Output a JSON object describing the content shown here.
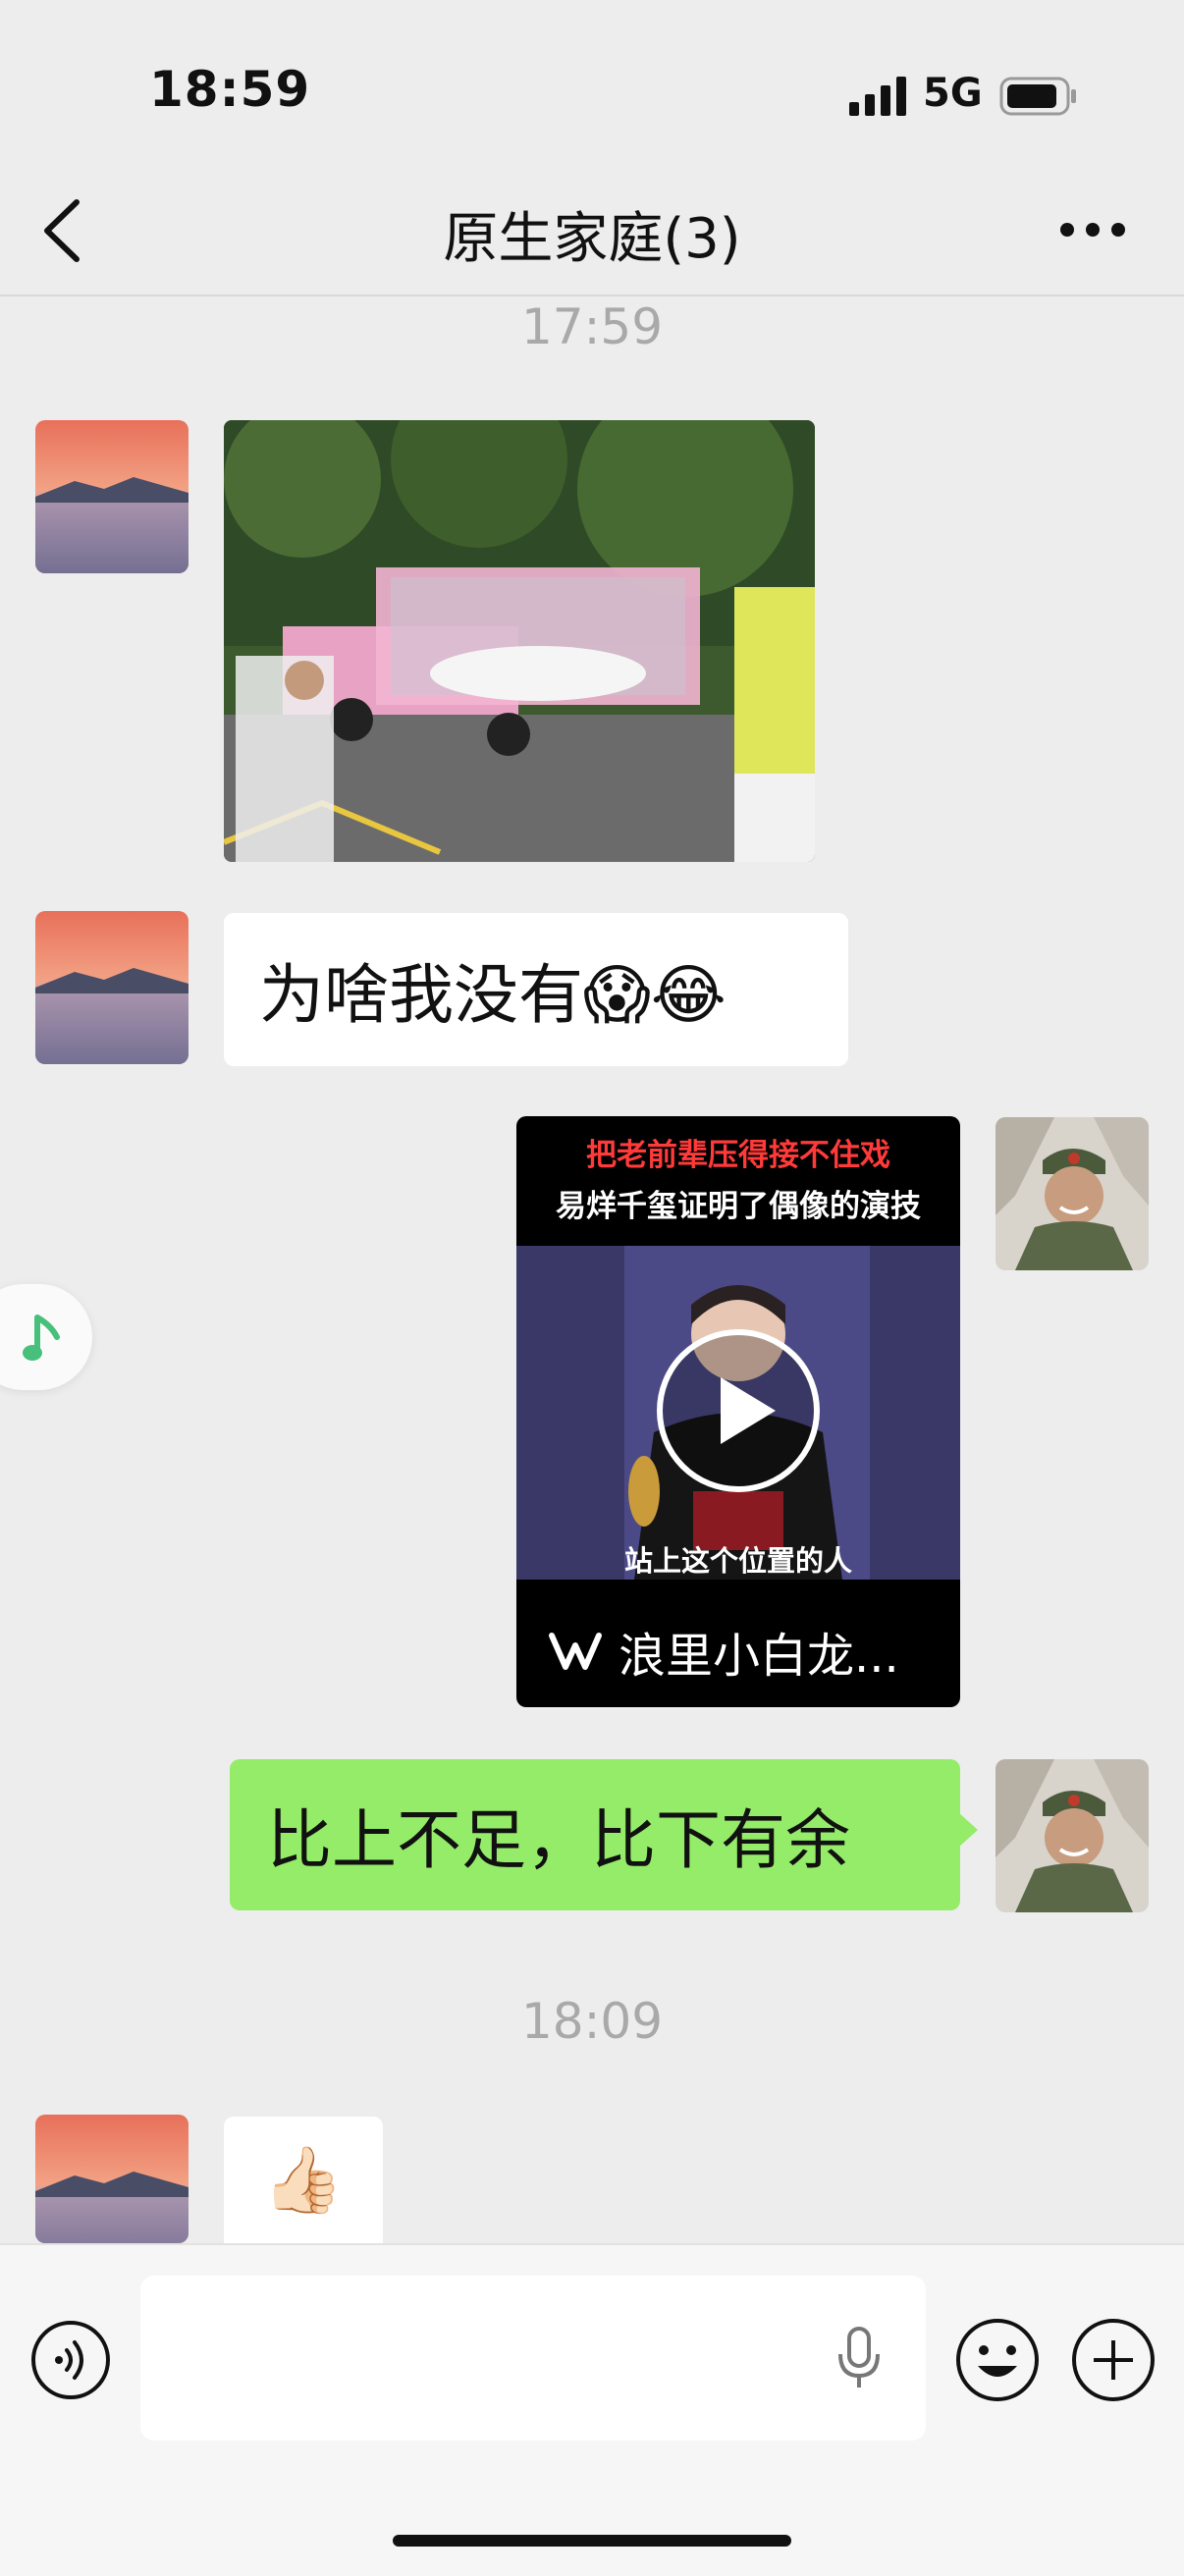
{
  "status_bar": {
    "time": "18:59",
    "network": "5G"
  },
  "nav": {
    "title": "原生家庭(3)"
  },
  "messages": {
    "timestamp_1": "17:59",
    "text_1": "为啥我没有😱😂",
    "video": {
      "caption_red": "把老前辈压得接不住戏",
      "caption_white": "易烊千玺证明了偶像的演技",
      "subtitle": "站上这个位置的人",
      "source": "浪里小白龙..."
    },
    "text_2": "比上不足，比下有余",
    "timestamp_2": "18:09",
    "sticker": "👍🏻"
  },
  "colors": {
    "accent_green": "#95ec69",
    "background": "#ededed",
    "timestamp": "#a9a9a9"
  },
  "icons": [
    "signal-icon",
    "battery-icon",
    "back-icon",
    "more-icon",
    "play-icon",
    "music-note-icon",
    "voice-icon",
    "mic-icon",
    "emoji-icon",
    "plus-icon"
  ]
}
